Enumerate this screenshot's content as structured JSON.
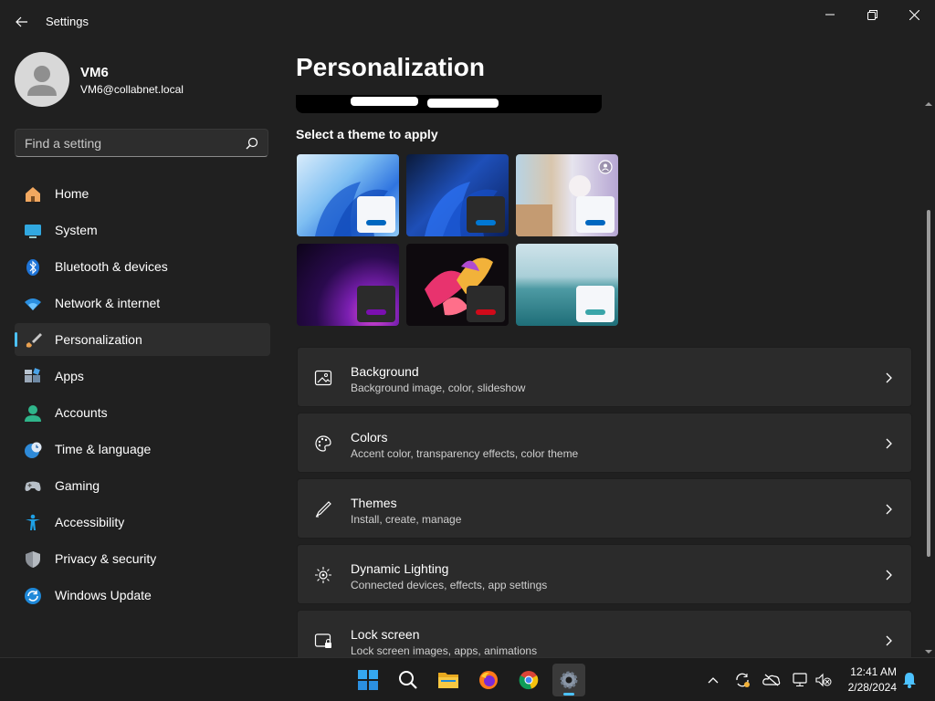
{
  "window": {
    "title": "Settings"
  },
  "profile": {
    "name": "VM6",
    "email": "VM6@collabnet.local"
  },
  "search": {
    "placeholder": "Find a setting"
  },
  "sidebar": {
    "items": [
      {
        "label": "Home",
        "icon": "home-icon"
      },
      {
        "label": "System",
        "icon": "system-icon"
      },
      {
        "label": "Bluetooth & devices",
        "icon": "bluetooth-icon"
      },
      {
        "label": "Network & internet",
        "icon": "wifi-icon"
      },
      {
        "label": "Personalization",
        "icon": "brush-icon",
        "selected": true
      },
      {
        "label": "Apps",
        "icon": "apps-icon"
      },
      {
        "label": "Accounts",
        "icon": "person-icon"
      },
      {
        "label": "Time & language",
        "icon": "clock-globe-icon"
      },
      {
        "label": "Gaming",
        "icon": "gamepad-icon"
      },
      {
        "label": "Accessibility",
        "icon": "accessibility-icon"
      },
      {
        "label": "Privacy & security",
        "icon": "shield-icon"
      },
      {
        "label": "Windows Update",
        "icon": "update-icon"
      }
    ]
  },
  "main": {
    "title": "Personalization",
    "themes_label": "Select a theme to apply",
    "themes": [
      {
        "name": "windows-light",
        "accent": "#0067c0"
      },
      {
        "name": "windows-dark",
        "accent": "#0078d4"
      },
      {
        "name": "glow",
        "accent": "#0067c0"
      },
      {
        "name": "captured-motion",
        "accent": "#7a0fb0"
      },
      {
        "name": "flow",
        "accent": "#d10a1a"
      },
      {
        "name": "sunrise",
        "accent": "#3aa5a9"
      }
    ],
    "cards": [
      {
        "title": "Background",
        "desc": "Background image, color, slideshow",
        "icon": "image-icon"
      },
      {
        "title": "Colors",
        "desc": "Accent color, transparency effects, color theme",
        "icon": "palette-icon"
      },
      {
        "title": "Themes",
        "desc": "Install, create, manage",
        "icon": "pen-icon"
      },
      {
        "title": "Dynamic Lighting",
        "desc": "Connected devices, effects, app settings",
        "icon": "lighting-icon"
      },
      {
        "title": "Lock screen",
        "desc": "Lock screen images, apps, animations",
        "icon": "lock-screen-icon"
      }
    ]
  },
  "taskbar": {
    "apps": [
      "start-icon",
      "search-icon",
      "file-explorer-icon",
      "firefox-icon",
      "chrome-icon",
      "settings-icon"
    ],
    "clock": {
      "time": "12:41 AM",
      "date": "2/28/2024"
    }
  },
  "colors": {
    "accent": "#4cc2ff",
    "background": "#202020",
    "card": "#2b2b2b"
  }
}
